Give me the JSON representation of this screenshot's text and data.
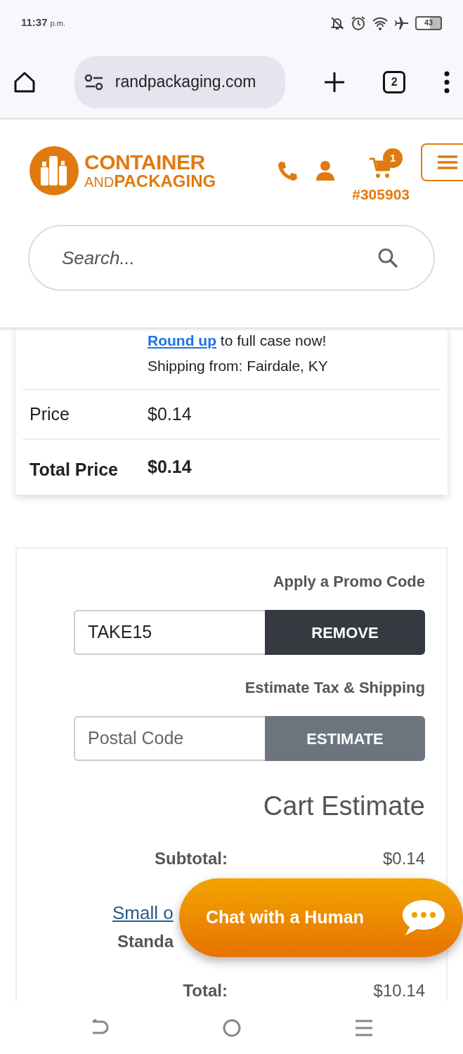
{
  "status_bar": {
    "time": "11:37",
    "period": "p.m.",
    "battery": "43"
  },
  "browser": {
    "url": "randpackaging.com",
    "tab_count": "2"
  },
  "site_header": {
    "logo_line1": "CONTAINER",
    "logo_and": "AND",
    "logo_line2": "PACKAGING",
    "cart_count": "1",
    "cart_number": "#305903",
    "search_placeholder": "Search..."
  },
  "item_card": {
    "note_link": "Round up",
    "note_text": "to full case now!",
    "shipping_from": "Shipping from: Fairdale, KY",
    "rows": [
      {
        "label": "Price",
        "value": "$0.14",
        "kind": "normal"
      },
      {
        "label": "Total Price",
        "value": "$0.14",
        "kind": "total"
      }
    ]
  },
  "cart_panel": {
    "promo_heading": "Apply a Promo Code",
    "promo_value": "TAKE15",
    "promo_button": "REMOVE",
    "estimate_heading": "Estimate Tax & Shipping",
    "postal_placeholder": "Postal Code",
    "estimate_button": "ESTIMATE",
    "title": "Cart Estimate",
    "subtotal_label": "Subtotal:",
    "subtotal_value": "$0.14",
    "small_order_link": "Small o",
    "standard_text": "Standa",
    "total_label": "Total:",
    "total_value": "$10.14"
  },
  "chat_button": {
    "label": "Chat with a Human"
  }
}
